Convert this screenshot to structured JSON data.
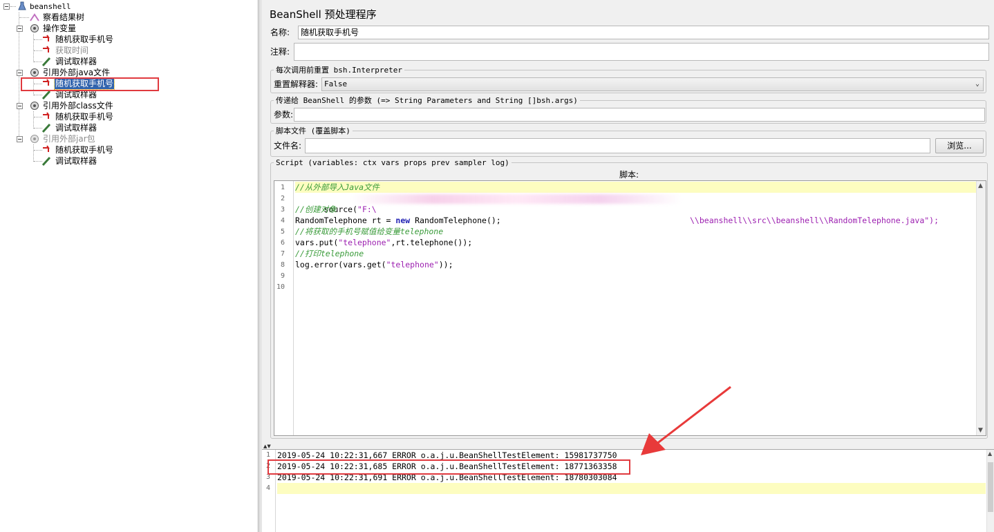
{
  "tree": {
    "root": "beanshell",
    "nodes": [
      {
        "label": "察看结果树"
      },
      {
        "label": "操作变量"
      },
      {
        "label": "随机获取手机号"
      },
      {
        "label": "获取时间"
      },
      {
        "label": "调试取样器"
      },
      {
        "label": "引用外部java文件"
      },
      {
        "label": "随机获取手机号"
      },
      {
        "label": "调试取样器"
      },
      {
        "label": "引用外部class文件"
      },
      {
        "label": "随机获取手机号"
      },
      {
        "label": "调试取样器"
      },
      {
        "label": "引用外部jar包"
      },
      {
        "label": "随机获取手机号"
      },
      {
        "label": "调试取样器"
      }
    ]
  },
  "panel": {
    "title": "BeanShell 预处理程序",
    "name_label": "名称:",
    "name_value": "随机获取手机号",
    "comment_label": "注释:",
    "comment_value": "",
    "reset_group": "每次调用前重置 bsh.Interpreter",
    "reset_label": "重置解释器:",
    "reset_value": "False",
    "params_group": "传递给 BeanShell 的参数 (=> String Parameters and String []bsh.args)",
    "params_label": "参数:",
    "params_value": "",
    "file_group": "脚本文件 (覆盖脚本)",
    "file_label": "文件名:",
    "file_value": "",
    "browse_label": "浏览...",
    "script_group": "Script (variables: ctx vars props prev sampler log)",
    "script_label": "脚本:"
  },
  "script_lines": [
    "//从外部导入Java文件",
    "source(\"F:\\",
    "//创建对象",
    "RandomTelephone rt = new RandomTelephone();",
    "//将获取的手机号赋值给变量telephone",
    "vars.put(\"telephone\",rt.telephone());",
    "//打印telephone",
    "log.error(vars.get(\"telephone\"));",
    "",
    ""
  ],
  "script_line2_tail": "\\\\beanshell\\\\src\\\\beanshell\\\\RandomTelephone.java\");",
  "log_lines": [
    "2019-05-24 10:22:31,667 ERROR o.a.j.u.BeanShellTestElement: 15981737750",
    "2019-05-24 10:22:31,685 ERROR o.a.j.u.BeanShellTestElement: 18771363358",
    "2019-05-24 10:22:31,691 ERROR o.a.j.u.BeanShellTestElement: 18780303084",
    ""
  ],
  "colors": {
    "highlight_box": "#e0393e",
    "selection": "#3163ad",
    "current_line": "#fdfdc0",
    "comment": "#3a9b3a",
    "string": "#9c1fb0",
    "keyword": "#2323b4"
  }
}
